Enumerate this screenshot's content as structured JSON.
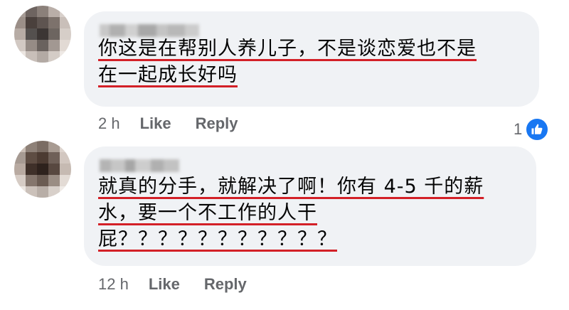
{
  "comments": [
    {
      "text_lines": [
        "你这是在帮别人养儿子，不是谈恋爱也不是",
        "在一起成长好吗"
      ],
      "time": "2 h",
      "like_label": "Like",
      "reply_label": "Reply",
      "reaction_count": "1"
    },
    {
      "text_lines": [
        "就真的分手，就解决了啊！你有 4-5 千的薪",
        "水，要一个不工作的人干",
        "屁？？？？？？？？？？？"
      ],
      "time": "12 h",
      "like_label": "Like",
      "reply_label": "Reply"
    }
  ],
  "colors": {
    "bubble": "#f0f2f5",
    "underline": "#d32027",
    "meta_text": "#65676b",
    "like_blue": "#1877f2"
  },
  "icons": {
    "reaction": "thumbs-up-icon"
  }
}
